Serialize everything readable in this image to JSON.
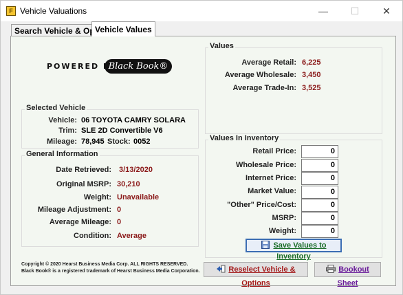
{
  "window": {
    "title": "Vehicle Valuations",
    "minimize": "—",
    "maximize": "☐",
    "close": "✕"
  },
  "tabs": [
    {
      "label": "Search Vehicle & Options"
    },
    {
      "label": "Vehicle Values"
    }
  ],
  "logo": {
    "powered_by": "POWERED BY",
    "brand": "Black Book®"
  },
  "selected_vehicle": {
    "title": "Selected Vehicle",
    "vehicle_label": "Vehicle:",
    "vehicle_value": "06 TOYOTA CAMRY SOLARA",
    "trim_label": "Trim:",
    "trim_value": "SLE 2D Convertible V6",
    "mileage_label": "Mileage:",
    "mileage_value": "78,945",
    "stock_label": "Stock:",
    "stock_value": "0052"
  },
  "general_info": {
    "title": "General Information",
    "rows": [
      {
        "label": "Date Retrieved:",
        "value": "3/13/2020"
      },
      {
        "label": "Original MSRP:",
        "value": "30,210"
      },
      {
        "label": "Weight:",
        "value": "Unavailable"
      },
      {
        "label": "Mileage Adjustment:",
        "value": "0"
      },
      {
        "label": "Average Mileage:",
        "value": "0"
      },
      {
        "label": "Condition:",
        "value": "Average"
      }
    ]
  },
  "values": {
    "title": "Values",
    "rows": [
      {
        "label": "Average Retail:",
        "value": "6,225"
      },
      {
        "label": "Average Wholesale:",
        "value": "3,450"
      },
      {
        "label": "Average Trade-In:",
        "value": "3,525"
      }
    ]
  },
  "inventory": {
    "title": "Values In Inventory",
    "rows": [
      {
        "label": "Retail Price:",
        "value": "0"
      },
      {
        "label": "Wholesale Price:",
        "value": "0"
      },
      {
        "label": "Internet Price:",
        "value": "0"
      },
      {
        "label": "Market Value:",
        "value": "0"
      },
      {
        "label": "\"Other\" Price/Cost:",
        "value": "0"
      },
      {
        "label": "MSRP:",
        "value": "0"
      },
      {
        "label": "Weight:",
        "value": "0"
      }
    ],
    "save_label": "Save Values to Inventory"
  },
  "buttons": {
    "reselect_label": "Reselect Vehicle & Options",
    "bookout_label": "Bookout Sheet"
  },
  "copyright": {
    "line1": "Copyright © 2020 Hearst Business Media Corp. ALL RIGHTS RESERVED.",
    "line2": "Black Book® is a registered trademark of Hearst Business Media Corporation."
  },
  "colors": {
    "value_red": "#8b1a1a",
    "save_green": "#176b25",
    "reselect_red": "#a31818",
    "bookout_purple": "#6a1b9a"
  }
}
